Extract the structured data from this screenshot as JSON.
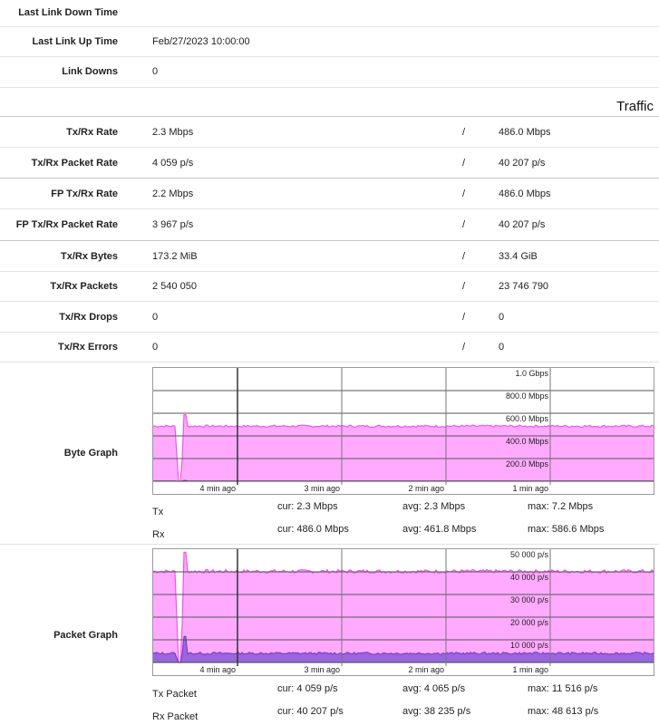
{
  "link": {
    "last_link_down_label": "Last Link Down Time",
    "last_link_down_value": "",
    "last_link_up_label": "Last Link Up Time",
    "last_link_up_value": "Feb/27/2023 10:00:00",
    "link_downs_label": "Link Downs",
    "link_downs_value": "0"
  },
  "traffic": {
    "title": "Traffic",
    "separator": "/",
    "rows": [
      {
        "label": "Tx/Rx Rate",
        "tx": "2.3 Mbps",
        "rx": "486.0 Mbps"
      },
      {
        "label": "Tx/Rx Packet Rate",
        "tx": "4 059 p/s",
        "rx": "40 207 p/s"
      },
      {
        "label": "FP Tx/Rx Rate",
        "tx": "2.2 Mbps",
        "rx": "486.0 Mbps"
      },
      {
        "label": "FP Tx/Rx Packet Rate",
        "tx": "3 967 p/s",
        "rx": "40 207 p/s"
      },
      {
        "label": "Tx/Rx Bytes",
        "tx": "173.2 MiB",
        "rx": "33.4 GiB"
      },
      {
        "label": "Tx/Rx Packets",
        "tx": "2 540 050",
        "rx": "23 746 790"
      },
      {
        "label": "Tx/Rx Drops",
        "tx": "0",
        "rx": "0"
      },
      {
        "label": "Tx/Rx Errors",
        "tx": "0",
        "rx": "0"
      }
    ]
  },
  "byte_graph": {
    "label": "Byte Graph",
    "y_ticks": [
      "1.0 Gbps",
      "800.0 Mbps",
      "600.0 Mbps",
      "400.0 Mbps",
      "200.0 Mbps"
    ],
    "x_ticks": [
      "4 min ago",
      "3 min ago",
      "2 min ago",
      "1 min ago"
    ],
    "tx": {
      "name": "Tx",
      "cur": "cur: 2.3 Mbps",
      "avg": "avg: 2.3 Mbps",
      "max": "max: 7.2 Mbps"
    },
    "rx": {
      "name": "Rx",
      "cur": "cur: 486.0 Mbps",
      "avg": "avg: 461.8 Mbps",
      "max": "max: 586.6 Mbps"
    },
    "colors": {
      "rx_fill": "#ffaaff",
      "rx_line": "#ee55ee",
      "tx_fill": "#9966dd",
      "tx_line": "#7733cc"
    }
  },
  "packet_graph": {
    "label": "Packet Graph",
    "y_ticks": [
      "50 000 p/s",
      "40 000 p/s",
      "30 000 p/s",
      "20 000 p/s",
      "10 000 p/s"
    ],
    "x_ticks": [
      "4 min ago",
      "3 min ago",
      "2 min ago",
      "1 min ago"
    ],
    "tx": {
      "name": "Tx Packet",
      "cur": "cur: 4 059 p/s",
      "avg": "avg: 4 065 p/s",
      "max": "max: 11 516 p/s"
    },
    "rx": {
      "name": "Rx Packet",
      "cur": "cur: 40 207 p/s",
      "avg": "avg: 38 235 p/s",
      "max": "max: 48 613 p/s"
    },
    "colors": {
      "rx_fill": "#ffaaff",
      "rx_line": "#ee55ee",
      "tx_fill": "#9966dd",
      "tx_line": "#7733cc"
    }
  },
  "chart_data": [
    {
      "type": "area",
      "ylim": [
        0,
        1000
      ],
      "yunit": "Mbps",
      "series": [
        {
          "name": "Rx",
          "level": 486.0,
          "drop_to": 0,
          "spike": 586.6
        },
        {
          "name": "Tx",
          "level": 2.3,
          "drop_to": 0,
          "spike": 7.2
        }
      ]
    },
    {
      "type": "area",
      "ylim": [
        0,
        50000
      ],
      "yunit": "p/s",
      "series": [
        {
          "name": "Rx Packet",
          "level": 40207,
          "drop_to": 0,
          "spike": 48613
        },
        {
          "name": "Tx Packet",
          "level": 4059,
          "drop_to": 0,
          "spike": 11516
        }
      ]
    }
  ]
}
